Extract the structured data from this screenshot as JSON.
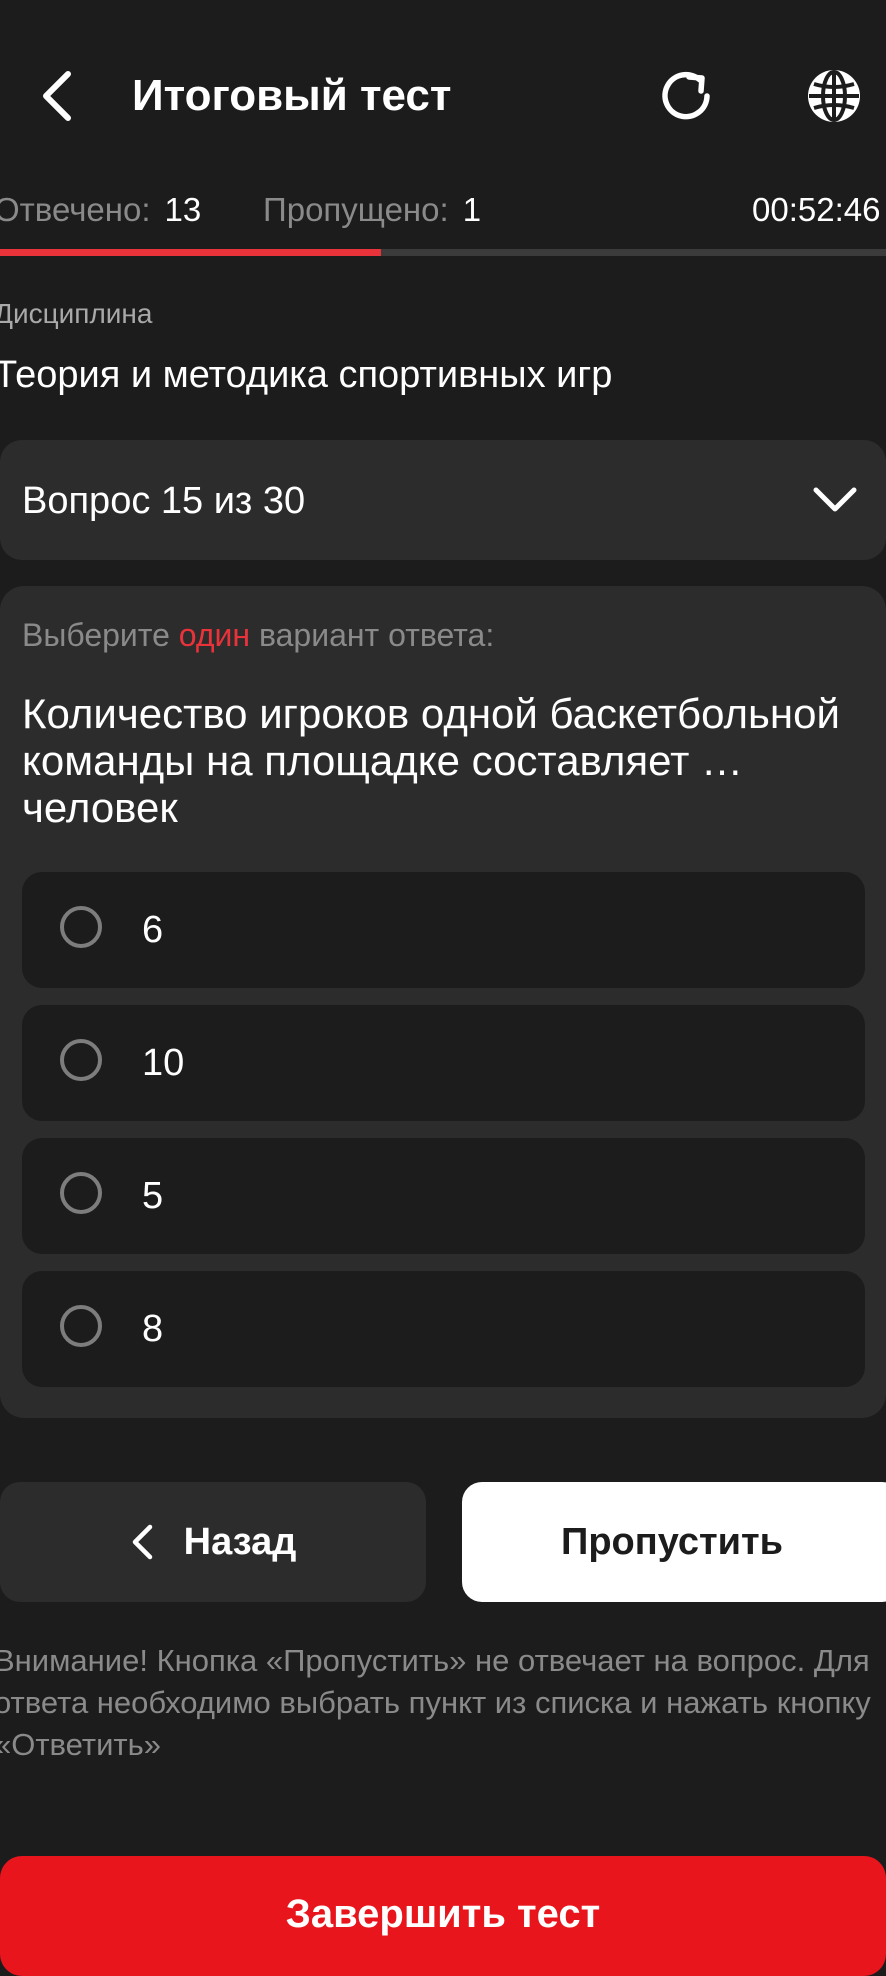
{
  "header": {
    "title": "Итоговый тест",
    "back_icon": "chevron-left-icon",
    "refresh_icon": "refresh-icon",
    "language_icon": "globe-icon"
  },
  "stats": {
    "answered_label": "Отвечено:",
    "answered_value": "13",
    "skipped_label": "Пропущено:",
    "skipped_value": "1",
    "timer": "00:52:46"
  },
  "progress": {
    "fraction": 0.43
  },
  "discipline": {
    "label": "Дисциплина",
    "value": "Теория и методика спортивных игр"
  },
  "question_selector": {
    "text": "Вопрос 15 из 30"
  },
  "question": {
    "instruction_pre": "Выберите ",
    "instruction_accent": "один",
    "instruction_post": " вариант ответа:",
    "text": "Количество игроков одной баскетбольной команды на площадке составляет … человек",
    "options": [
      "6",
      "10",
      "5",
      "8"
    ]
  },
  "buttons": {
    "back": "Назад",
    "skip": "Пропустить",
    "finish": "Завершить тест"
  },
  "notice": "Внимание! Кнопка «Пропустить» не отвечает на вопрос. Для ответа необходимо выбрать пункт из списка и нажать кнопку «Ответить»",
  "colors": {
    "background": "#1c1c1c",
    "card": "#2c2c2c",
    "accent": "#e8333b",
    "finish": "#e8161c"
  }
}
